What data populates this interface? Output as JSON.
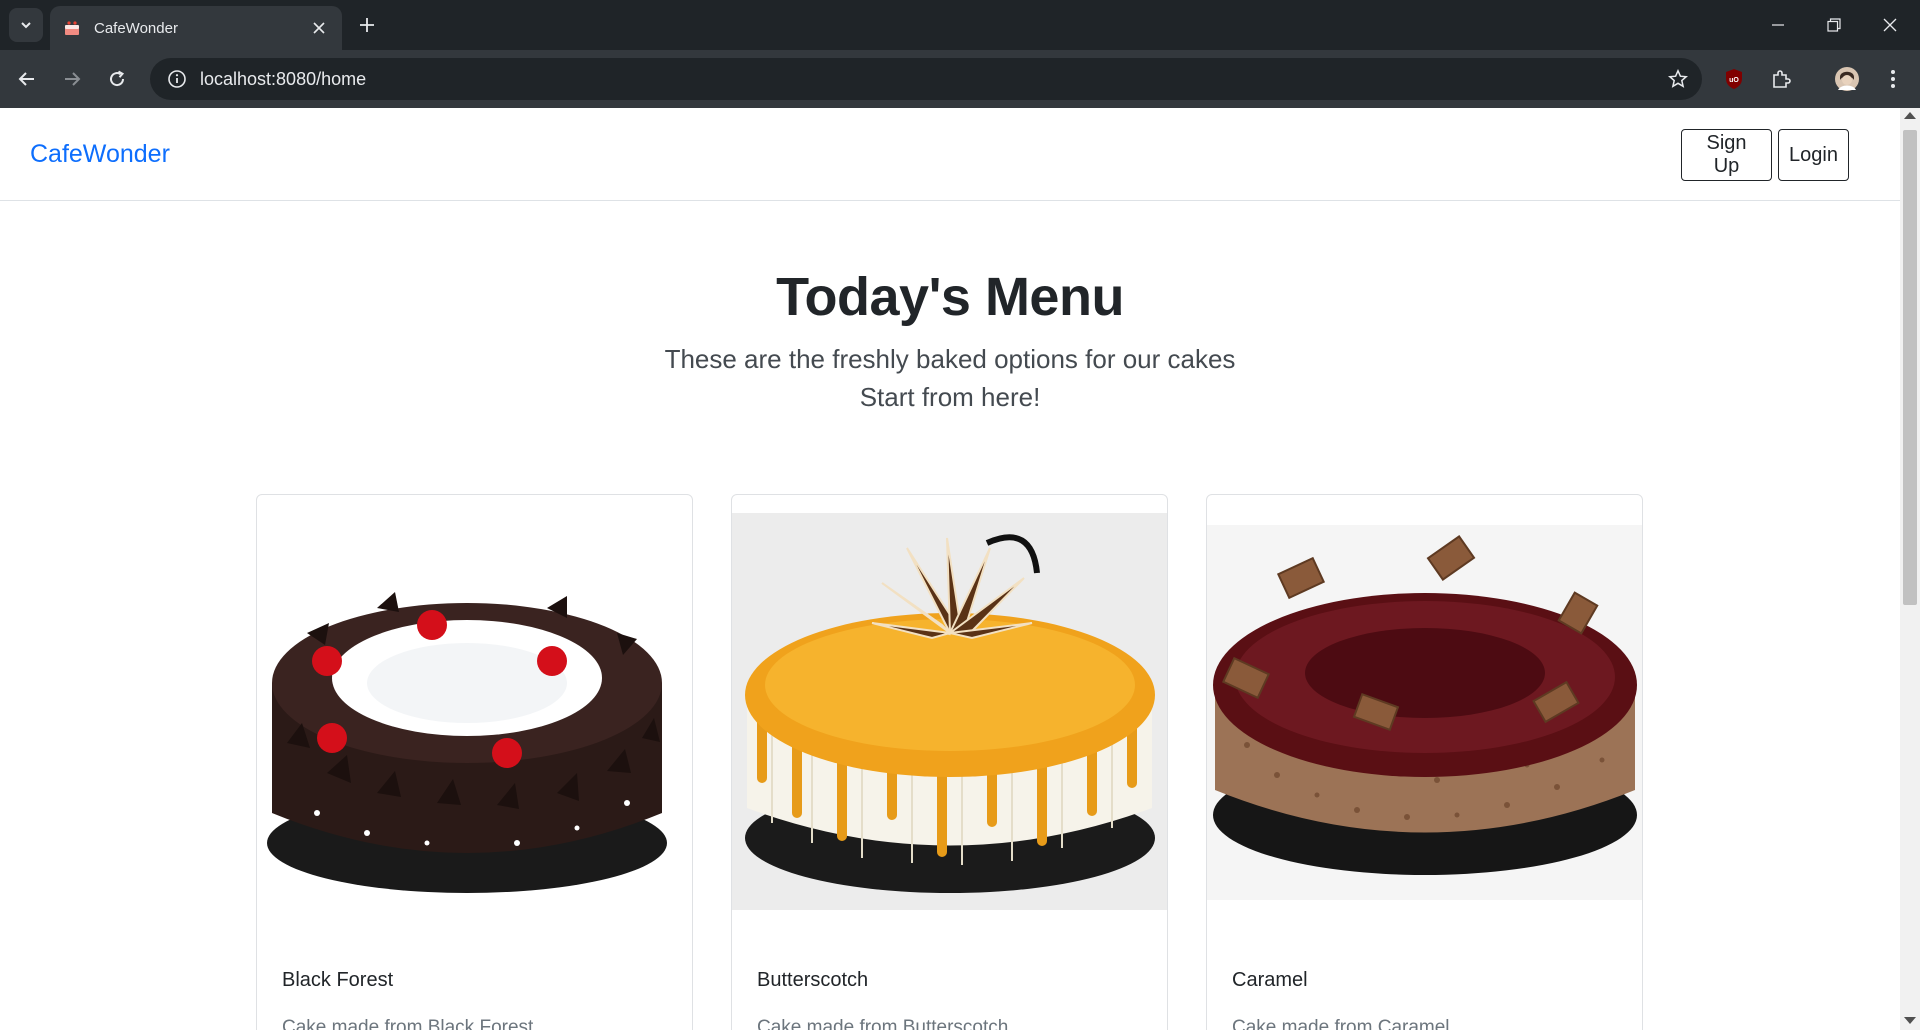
{
  "browser": {
    "tab_title": "CafeWonder",
    "url": "localhost:8080/home"
  },
  "navbar": {
    "brand": "CafeWonder",
    "signup_label": "Sign Up",
    "login_label": "Login"
  },
  "hero": {
    "title": "Today's Menu",
    "subtitle_line1": "These are the freshly baked options for our cakes",
    "subtitle_line2": "Start from here!"
  },
  "cards": [
    {
      "title": "Black Forest",
      "text": "Cake made from Black Forest",
      "image": "black-forest-cake"
    },
    {
      "title": "Butterscotch",
      "text": "Cake made from Butterscotch",
      "image": "butterscotch-cake"
    },
    {
      "title": "Caramel",
      "text": "Cake made from Caramel",
      "image": "caramel-cake"
    }
  ],
  "colors": {
    "brand": "#0d6efd",
    "chrome_dark": "#1f2428",
    "chrome_mid": "#33383d"
  }
}
